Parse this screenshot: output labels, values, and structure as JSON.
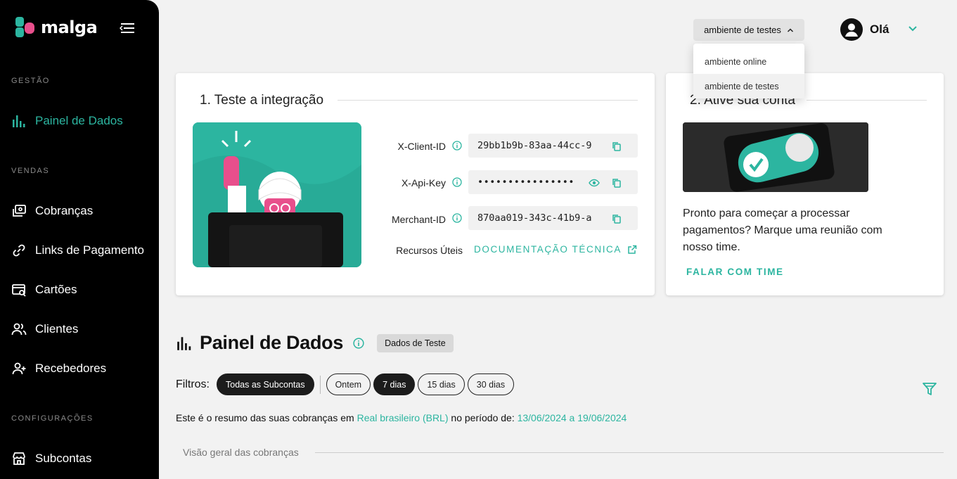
{
  "brand": {
    "name": "malga"
  },
  "colors": {
    "accent": "#2cb5a0",
    "sidebar": "#000000",
    "brand_pink": "#e84f8c"
  },
  "sidebar": {
    "sections": [
      {
        "label": "GESTÃO"
      },
      {
        "label": "VENDAS"
      },
      {
        "label": "CONFIGURAÇÕES"
      }
    ],
    "items": [
      {
        "label": "Painel de Dados",
        "icon": "bar-chart-icon",
        "active": true
      },
      {
        "label": "Cobranças",
        "icon": "charges-icon"
      },
      {
        "label": "Links de Pagamento",
        "icon": "link-icon"
      },
      {
        "label": "Cartões",
        "icon": "card-search-icon"
      },
      {
        "label": "Clientes",
        "icon": "users-icon"
      },
      {
        "label": "Recebedores",
        "icon": "user-plus-icon"
      },
      {
        "label": "Subcontas",
        "icon": "store-icon"
      }
    ]
  },
  "topbar": {
    "environment": {
      "selected": "ambiente de testes",
      "options": [
        "ambiente online",
        "ambiente de testes"
      ]
    },
    "greeting": "Olá"
  },
  "integration": {
    "title": "1. Teste a integração",
    "credentials": [
      {
        "label": "X-Client-ID",
        "value": "29bb1b9b-83aa-44cc-9"
      },
      {
        "label": "X-Api-Key",
        "value": "••••••••••••••••"
      },
      {
        "label": "Merchant-ID",
        "value": "870aa019-343c-41b9-a"
      }
    ],
    "resources_label": "Recursos Úteis",
    "doc_link": "DOCUMENTAÇÃO TÉCNICA"
  },
  "activate": {
    "title": "2. Ative sua conta",
    "text": "Pronto para começar a processar pagamentos? Marque uma reunião com nosso time.",
    "cta": "FALAR COM TIME"
  },
  "dashboard": {
    "title": "Painel de Dados",
    "badge": "Dados de Teste",
    "filters_label": "Filtros:",
    "subaccount_chip": "Todas as Subcontas",
    "period_chips": [
      {
        "label": "Ontem",
        "active": false
      },
      {
        "label": "7 dias",
        "active": true
      },
      {
        "label": "15 dias",
        "active": false
      },
      {
        "label": "30 dias",
        "active": false
      }
    ],
    "summary_prefix": "Este é o resumo das suas cobranças em",
    "currency": "Real brasileiro (BRL)",
    "summary_mid": "no período de:",
    "period": "13/06/2024 a 19/06/2024",
    "overview_label": "Visão geral das cobranças"
  }
}
